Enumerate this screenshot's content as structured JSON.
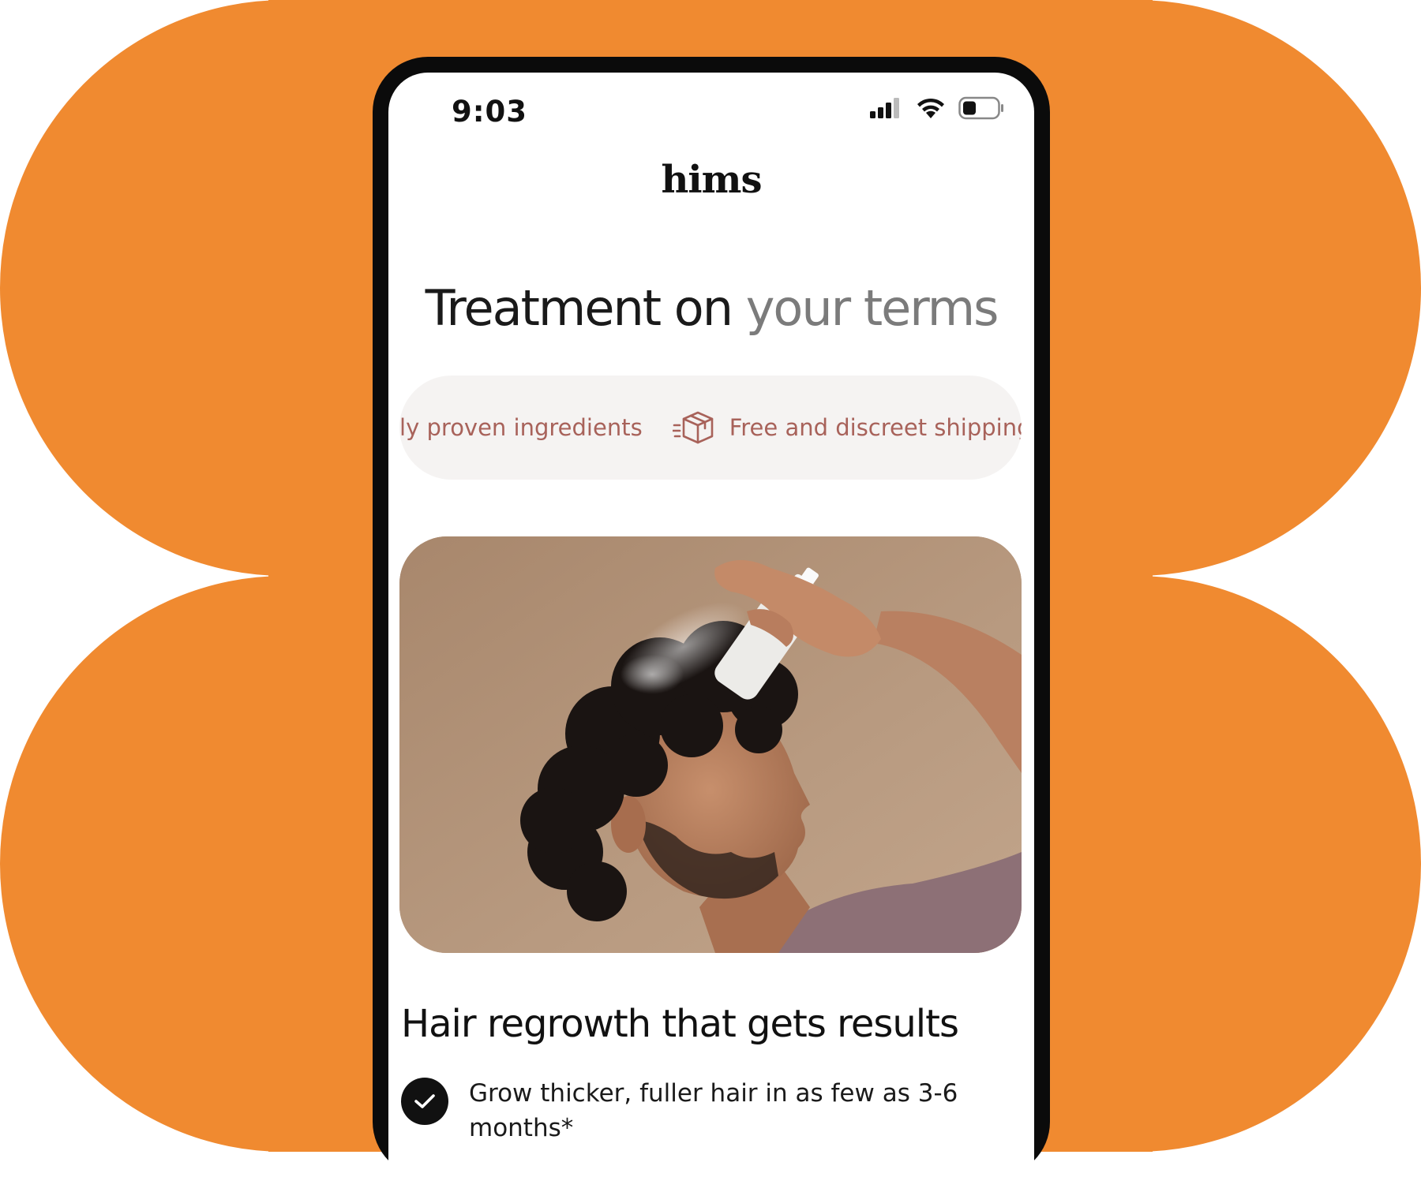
{
  "status_bar": {
    "time": "9:03",
    "signal_icon": "cellular-signal-icon",
    "wifi_icon": "wifi-icon",
    "battery_icon": "battery-icon"
  },
  "brand": {
    "logo": "hims"
  },
  "hero": {
    "headline_primary": "Treatment on ",
    "headline_muted": "your terms"
  },
  "marquee": {
    "items": [
      {
        "label": "lly proven ingredients",
        "icon": ""
      },
      {
        "label": "Free and discreet shipping",
        "icon": "package-icon"
      }
    ]
  },
  "photo": {
    "description_icon": "man-applying-hair-spray-photo"
  },
  "section": {
    "title": "Hair regrowth that gets results"
  },
  "benefits": [
    {
      "text": "Grow thicker, fuller hair in as few as 3-6 months*",
      "icon": "check-icon"
    }
  ],
  "colors": {
    "background_orange": "#f08a30",
    "phone_frame": "#0b0b0b",
    "accent_rose": "#a8625a",
    "muted_text": "#7b7b7b",
    "pill_bg": "#f5f3f2"
  }
}
